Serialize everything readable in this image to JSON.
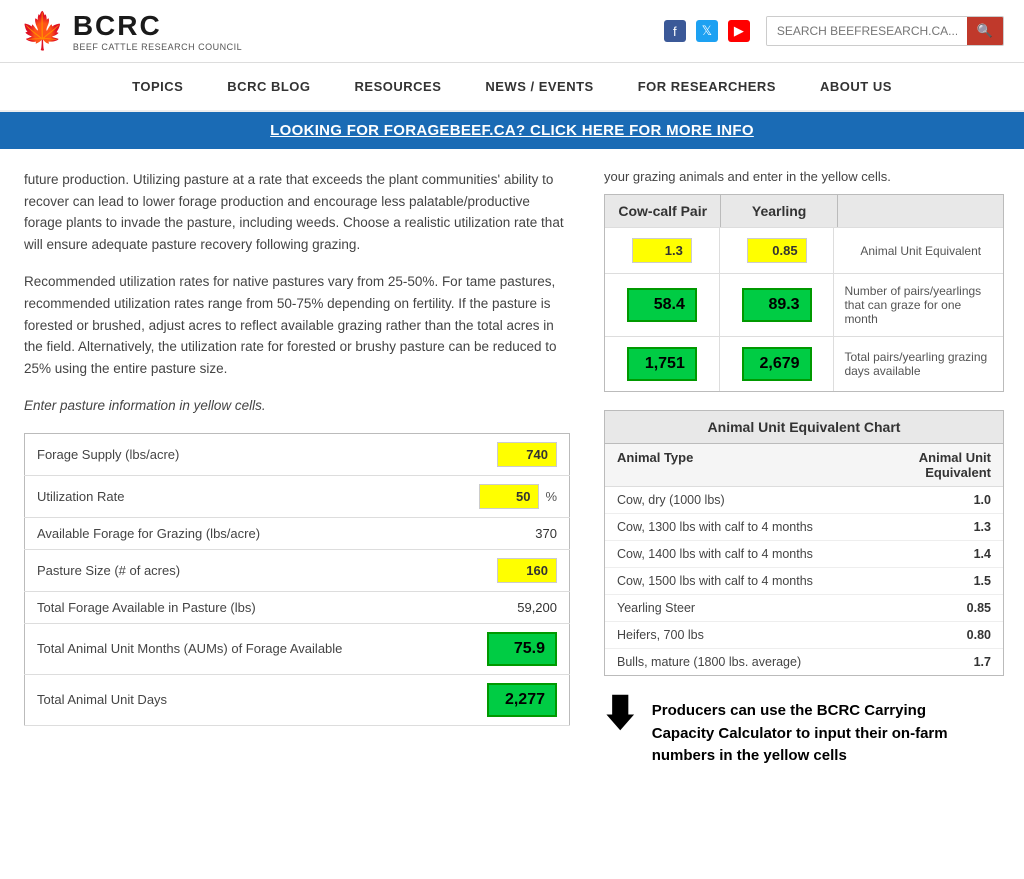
{
  "header": {
    "logo_bcrc": "BCRC",
    "logo_sub": "BEEF CATTLE RESEARCH COUNCIL",
    "search_placeholder": "SEARCH BEEFRESEARCH.CA...",
    "social": [
      {
        "name": "facebook",
        "label": "f"
      },
      {
        "name": "twitter",
        "label": "𝕏"
      },
      {
        "name": "youtube",
        "label": "▶"
      }
    ]
  },
  "nav": {
    "items": [
      {
        "label": "TOPICS"
      },
      {
        "label": "BCRC BLOG"
      },
      {
        "label": "RESOURCES"
      },
      {
        "label": "NEWS / EVENTS"
      },
      {
        "label": "FOR RESEARCHERS"
      },
      {
        "label": "ABOUT US"
      }
    ]
  },
  "banner": {
    "text": "LOOKING FOR FORAGEBEEF.CA? CLICK HERE FOR MORE INFO"
  },
  "left_text": {
    "para1": "future production. Utilizing pasture at a rate that exceeds the plant communities' ability to recover can lead to lower forage production and encourage less palatable/productive forage plants to invade the pasture, including weeds. Choose a realistic utilization rate that will ensure adequate pasture recovery following grazing.",
    "para2": "Recommended utilization rates for native pastures vary from 25-50%. For tame pastures, recommended utilization rates range from 50-75% depending on fertility. If the pasture is forested or brushed, adjust acres to reflect available grazing rather than the total acres in the field. Alternatively, the utilization rate for forested or brushy pasture can be reduced to 25% using the entire pasture size.",
    "enter_label": "Enter pasture information in yellow cells."
  },
  "calc": {
    "rows": [
      {
        "label": "Forage Supply (lbs/acre)",
        "value": "740",
        "type": "yellow",
        "suffix": ""
      },
      {
        "label": "Utilization Rate",
        "value": "50",
        "type": "yellow",
        "suffix": "%"
      },
      {
        "label": "Available Forage for Grazing (lbs/acre)",
        "value": "370",
        "type": "static",
        "suffix": ""
      },
      {
        "label": "Pasture Size (# of acres)",
        "value": "160",
        "type": "yellow",
        "suffix": ""
      },
      {
        "label": "Total Forage Available in Pasture (lbs)",
        "value": "59,200",
        "type": "static",
        "suffix": ""
      },
      {
        "label": "Total Animal Unit Months (AUMs) of Forage Available",
        "value": "75.9",
        "type": "green",
        "suffix": ""
      },
      {
        "label": "Total Animal Unit Days",
        "value": "2,277",
        "type": "green",
        "suffix": ""
      }
    ]
  },
  "right_top_text": "your grazing animals and enter in the yellow cells.",
  "grazing_cols": [
    "Cow-calf Pair",
    "Yearling"
  ],
  "grazing_rows": [
    {
      "cow_val": "1.3",
      "cow_type": "yellow",
      "year_val": "0.85",
      "year_type": "yellow",
      "label": "Animal Unit Equivalent"
    },
    {
      "cow_val": "58.4",
      "cow_type": "green",
      "year_val": "89.3",
      "year_type": "green",
      "label": "Number of pairs/yearlings that can graze for one month"
    },
    {
      "cow_val": "1,751",
      "cow_type": "green",
      "year_val": "2,679",
      "year_type": "green",
      "label": "Total pairs/yearling grazing days available"
    }
  ],
  "aue_chart": {
    "title": "Animal Unit Equivalent Chart",
    "col1": "Animal Type",
    "col2": "Animal Unit Equivalent",
    "rows": [
      {
        "animal": "Cow, dry (1000 lbs)",
        "aue": "1.0"
      },
      {
        "animal": "Cow, 1300 lbs with calf to 4 months",
        "aue": "1.3"
      },
      {
        "animal": "Cow, 1400 lbs with calf to 4 months",
        "aue": "1.4"
      },
      {
        "animal": "Cow, 1500 lbs with calf to 4 months",
        "aue": "1.5"
      },
      {
        "animal": "Yearling Steer",
        "aue": "0.85"
      },
      {
        "animal": "Heifers, 700 lbs",
        "aue": "0.80"
      },
      {
        "animal": "Bulls, mature (1800 lbs. average)",
        "aue": "1.7"
      }
    ]
  },
  "caption": "Producers can use the BCRC Carrying Capacity Calculator to input their on-farm numbers in the yellow cells"
}
